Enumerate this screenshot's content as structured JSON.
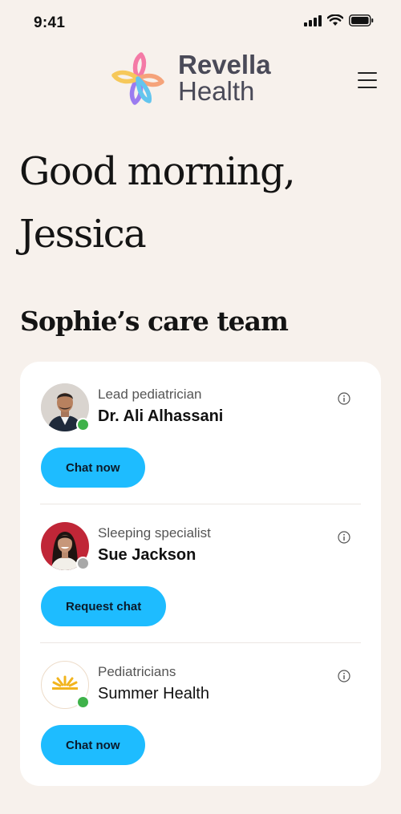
{
  "status": {
    "time": "9:41"
  },
  "brand": {
    "line1": "Revella",
    "line2": "Health"
  },
  "greeting": {
    "line1": "Good morning,",
    "line2": "Jessica"
  },
  "care_team": {
    "title": "Sophie’s care team",
    "members": [
      {
        "role": "Lead pediatrician",
        "name": "Dr. Ali Alhassani",
        "status": "online",
        "action": "Chat now"
      },
      {
        "role": "Sleeping specialist",
        "name": "Sue Jackson",
        "status": "away",
        "action": "Request chat"
      },
      {
        "role": "Pediatricians",
        "name": "Summer Health",
        "status": "online",
        "action": "Chat now"
      }
    ]
  },
  "colors": {
    "accent": "#1ebcff",
    "online": "#3fb24a",
    "away": "#a8a8a8",
    "background": "#f7f1ec"
  },
  "icons": [
    "signal-icon",
    "wifi-icon",
    "battery-icon",
    "menu-icon",
    "info-icon",
    "presence-dot-icon"
  ]
}
